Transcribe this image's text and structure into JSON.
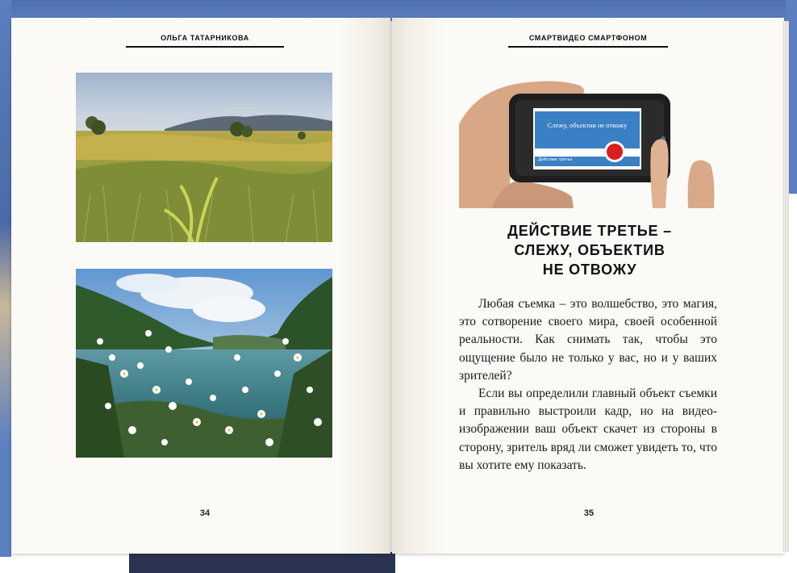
{
  "left_page": {
    "running_head": "Ольга Татарникова",
    "page_number": "34",
    "photos": [
      {
        "icon": "meadow-landscape-photo"
      },
      {
        "icon": "lake-daisies-photo"
      }
    ]
  },
  "right_page": {
    "running_head": "Смартвидео смартфоном",
    "page_number": "35",
    "illustration": {
      "icon": "hand-holding-phone-illustration",
      "screen_title": "Слежу, объектив не отвожу",
      "screen_caption": "Действие третье"
    },
    "chapter_title": [
      "Действие третье –",
      "слежу, объектив",
      "не отвожу"
    ],
    "paragraphs": [
      "Любая съемка – это волшебство, это магия, это сотворение своего мира, своей особенной реальности. Как снимать так, чтобы это ощущение было не только у вас, но и у ваших зрителей?",
      "Если вы определили главный объект съемки и правильно выстроили кадр, но на видео-изображении ваш объект скачет из стороны в сторону, зритель вряд ли сможет увидеть то, что вы хотите ему показать."
    ]
  },
  "colors": {
    "accent_blue": "#3b7fc4",
    "record_red": "#d91e1e",
    "page": "#fbfaf7"
  }
}
